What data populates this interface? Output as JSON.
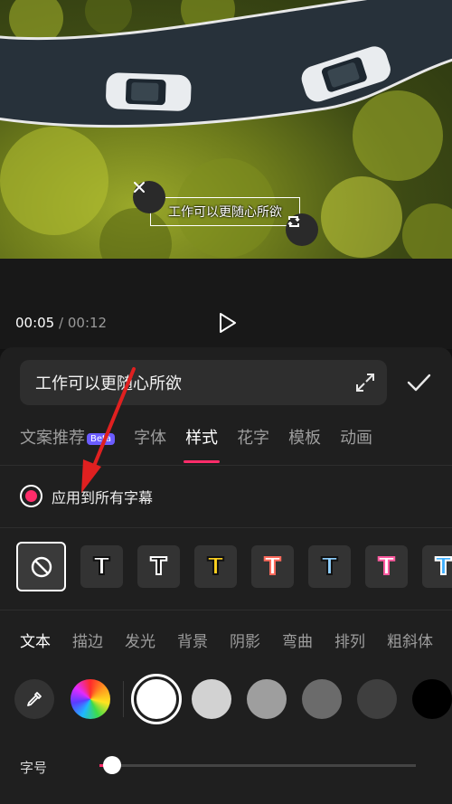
{
  "video": {
    "caption": "工作可以更随心所欲",
    "close_icon": "close-icon",
    "rotate_icon": "rotate-scale-icon"
  },
  "playback": {
    "current_time": "00:05",
    "separator": "/",
    "total_time": "00:12",
    "play_icon": "play-icon"
  },
  "editor": {
    "input_value": "工作可以更随心所欲",
    "expand_icon": "expand-icon",
    "confirm_icon": "check-icon",
    "tabs": [
      {
        "label": "文案推荐",
        "badge": "Beta"
      },
      {
        "label": "字体"
      },
      {
        "label": "样式"
      },
      {
        "label": "花字"
      },
      {
        "label": "模板"
      },
      {
        "label": "动画"
      }
    ],
    "active_tab": "样式",
    "apply_all_label": "应用到所有字幕",
    "apply_all_checked": true,
    "presets": [
      {
        "glyph": "T",
        "fill": "#ffffff",
        "stroke": "#111111"
      },
      {
        "glyph": "T",
        "fill": "#111111",
        "stroke": "#ffffff"
      },
      {
        "glyph": "T",
        "fill": "#ffd21f",
        "stroke": "#111111"
      },
      {
        "glyph": "T",
        "fill": "#ffffff",
        "stroke": "#ff6a5c"
      },
      {
        "glyph": "T",
        "fill": "#8fd0ff",
        "stroke": "#111111"
      },
      {
        "glyph": "T",
        "fill": "#ffffff",
        "stroke": "#ff5aa0"
      },
      {
        "glyph": "T",
        "fill": "#3fb0ff",
        "stroke": "#ffffff"
      }
    ],
    "subtabs": [
      "文本",
      "描边",
      "发光",
      "背景",
      "阴影",
      "弯曲",
      "排列",
      "粗斜体"
    ],
    "active_subtab": "文本",
    "swatches": [
      "#ffffff",
      "#d2d2d2",
      "#9e9e9e",
      "#6b6b6b",
      "#3f3f3f",
      "#000000"
    ],
    "selected_swatch": "#ffffff",
    "size_label": "字号",
    "size_value_fraction": 0.04
  },
  "colors": {
    "accent": "#ff2c6a",
    "annotation_arrow": "#e02020"
  }
}
